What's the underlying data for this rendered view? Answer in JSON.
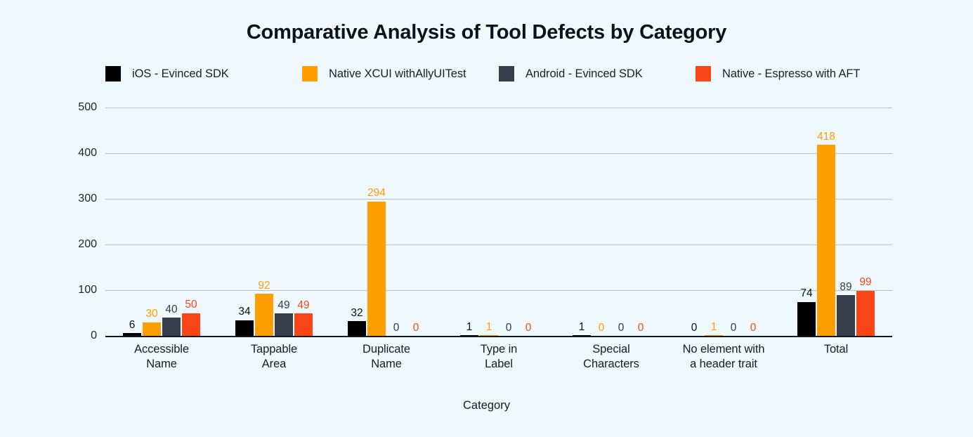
{
  "background_color": "#eff8fc",
  "title": "Comparative Analysis of Tool Defects by Category",
  "axis_title_x": "Category",
  "legend": {
    "items": [
      {
        "label": "iOS - Evinced SDK",
        "color": "#000000"
      },
      {
        "label": "Native XCUI withAllyUITest",
        "color": "#ff9e00"
      },
      {
        "label": "Android - Evinced SDK",
        "color": "#353d4a"
      },
      {
        "label": "Native - Espresso with AFT",
        "color": "#fa4616"
      }
    ]
  },
  "chart_data": {
    "type": "bar",
    "title": "Comparative Analysis of Tool Defects by Category",
    "xlabel": "Category",
    "ylabel": "",
    "ylim": [
      0,
      500
    ],
    "yticks": [
      0,
      100,
      200,
      300,
      400,
      500
    ],
    "grid": true,
    "legend_position": "top",
    "categories": [
      "Accessible Name",
      "Tappable Area",
      "Duplicate Name",
      "Type in Label",
      "Special Characters",
      "No element with a header trait",
      "Total"
    ],
    "category_lines": [
      [
        "Accessible",
        "Name"
      ],
      [
        "Tappable",
        "Area"
      ],
      [
        "Duplicate",
        "Name"
      ],
      [
        "Type in",
        "Label"
      ],
      [
        "Special",
        "Characters"
      ],
      [
        "No element with",
        "a header trait"
      ],
      [
        "Total",
        ""
      ]
    ],
    "series": [
      {
        "name": "iOS - Evinced SDK",
        "color": "#000000",
        "values": [
          6,
          34,
          32,
          1,
          1,
          0,
          74
        ]
      },
      {
        "name": "Native XCUI withAllyUITest",
        "color": "#ff9e00",
        "values": [
          30,
          92,
          294,
          1,
          0,
          1,
          418
        ]
      },
      {
        "name": "Android - Evinced SDK",
        "color": "#353d4a",
        "values": [
          40,
          49,
          0,
          0,
          0,
          0,
          89
        ]
      },
      {
        "name": "Native - Espresso with AFT",
        "color": "#fa4616",
        "values": [
          50,
          49,
          0,
          0,
          0,
          0,
          99
        ]
      }
    ]
  }
}
